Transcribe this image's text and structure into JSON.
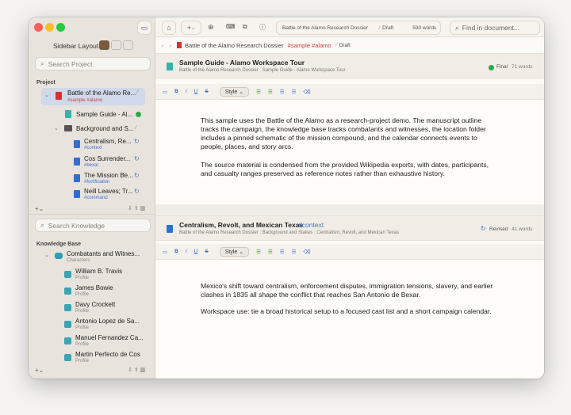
{
  "toolbar": {
    "title_chip": {
      "project": "Battle of the Alamo Research Dossier",
      "status": "Draft",
      "word_count": "590 words"
    },
    "find_placeholder": "Find in document...",
    "add_symbol": "+"
  },
  "breadcrumb": {
    "project": "Battle of the Alamo Research Dossier",
    "tags": "#sample #alamo",
    "status": "Draft"
  },
  "sidebar": {
    "layout_label": "Sidebar Layout",
    "search_project_placeholder": "Search Project",
    "project_heading": "Project",
    "project_items": [
      {
        "title": "Battle of the Alamo Re...",
        "tags": "#sample #alamo"
      },
      {
        "title": "Sample Guide - Al..."
      },
      {
        "title": "Background and S..."
      },
      {
        "title": "Centralism, Re...",
        "tags": "#context"
      },
      {
        "title": "Cos Surrender...",
        "tags": "#bexar"
      },
      {
        "title": "The Mission Be...",
        "tags": "#fortification"
      },
      {
        "title": "Neill Leaves; Tr...",
        "tags": "#command"
      }
    ],
    "search_knowledge_placeholder": "Search Knowledge",
    "knowledge_heading": "Knowledge Base",
    "knowledge_group": {
      "title": "Combatants and Witnes...",
      "subtitle": "Characters"
    },
    "knowledge_items": [
      {
        "name": "William B. Travis",
        "kind": "Profile"
      },
      {
        "name": "James Bowie",
        "kind": "Profile"
      },
      {
        "name": "Davy Crockett",
        "kind": "Profile"
      },
      {
        "name": "Antonio Lopez de Sa...",
        "kind": "Profile"
      },
      {
        "name": "Manuel Fernandez Ca...",
        "kind": "Profile"
      },
      {
        "name": "Martin Perfecto de Cos",
        "kind": "Profile"
      }
    ],
    "add_label": "+"
  },
  "sections": [
    {
      "title": "Sample Guide - Alamo Workspace Tour",
      "tag": "",
      "path": "Battle of the Alamo Research Dossier : Sample Guide - Alamo Workspace Tour",
      "status": "Final",
      "words": "71 words",
      "paragraphs": [
        "This sample uses the Battle of the Alamo as a research-project demo. The manuscript outline tracks the campaign, the knowledge base tracks combatants and witnesses, the location folder includes a pinned schematic of the mission compound, and the calendar connects events to people, places, and story arcs.",
        "The source material is condensed from the provided Wikipedia exports, with dates, participants, and casualty ranges preserved as reference notes rather than exhaustive history."
      ]
    },
    {
      "title": "Centralism, Revolt, and Mexican Texas",
      "tag": "#context",
      "path": "Battle of the Alamo Research Dossier : Background and Stakes : Centralism, Revolt, and Mexican Texas",
      "status": "Revised",
      "words": "41 words",
      "paragraphs": [
        "Mexico's shift toward centralism, enforcement disputes, immigration tensions, slavery, and earlier clashes in 1835 all shape the conflict that reaches San Antonio de Bexar.",
        "Workspace use: tie a broad historical setup to a focused cast list and a short campaign calendar."
      ]
    }
  ],
  "format_bar": {
    "style_label": "Style"
  }
}
